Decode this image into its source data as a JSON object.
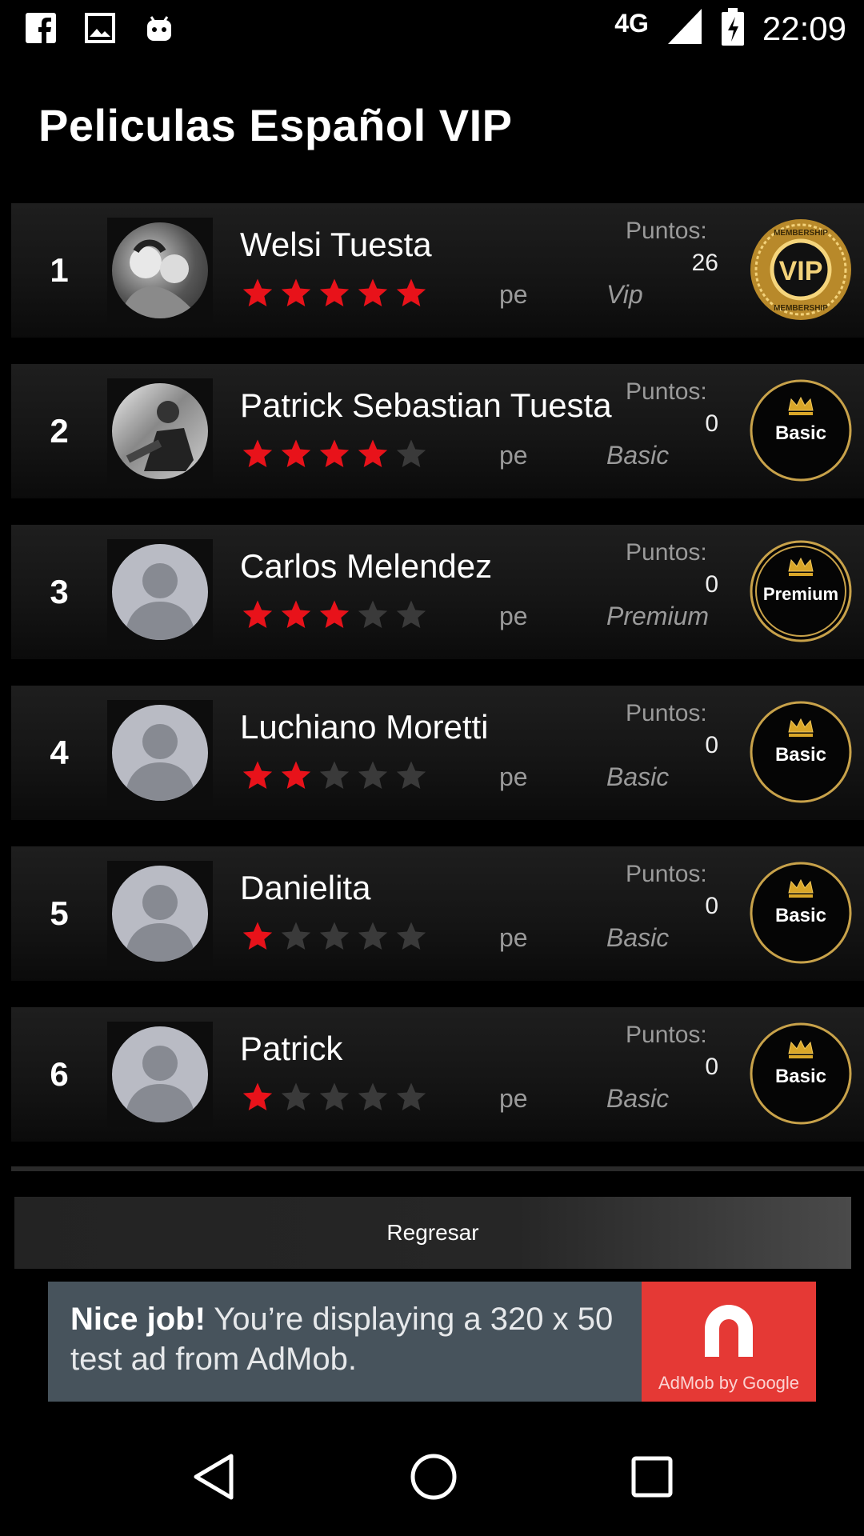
{
  "status_bar": {
    "network": "4G",
    "time": "22:09"
  },
  "title": "Peliculas Español VIP",
  "rows": [
    {
      "rank": "1",
      "name": "Welsi Tuesta",
      "rating": 5,
      "country": "pe",
      "points_label": "Puntos:",
      "points": "26",
      "tier": "Vip",
      "badge": "VIP",
      "badge_ring": [
        "MEMBERSHIP",
        "MEMBERSHIP"
      ]
    },
    {
      "rank": "2",
      "name": "Patrick Sebastian Tuesta",
      "rating": 4,
      "country": "pe",
      "points_label": "Puntos:",
      "points": "0",
      "tier": "Basic",
      "badge": "Basic"
    },
    {
      "rank": "3",
      "name": "Carlos Melendez",
      "rating": 3,
      "country": "pe",
      "points_label": "Puntos:",
      "points": "0",
      "tier": "Premium",
      "badge": "Premium"
    },
    {
      "rank": "4",
      "name": "Luchiano Moretti",
      "rating": 2,
      "country": "pe",
      "points_label": "Puntos:",
      "points": "0",
      "tier": "Basic",
      "badge": "Basic"
    },
    {
      "rank": "5",
      "name": "Danielita",
      "rating": 1,
      "country": "pe",
      "points_label": "Puntos:",
      "points": "0",
      "tier": "Basic",
      "badge": "Basic"
    },
    {
      "rank": "6",
      "name": "Patrick",
      "rating": 1,
      "country": "pe",
      "points_label": "Puntos:",
      "points": "0",
      "tier": "Basic",
      "badge": "Basic"
    }
  ],
  "back_button": "Regresar",
  "ad": {
    "bold": "Nice job!",
    "text": " You’re displaying a 320 x 50 test ad from AdMob.",
    "brand": "AdMob by Google"
  },
  "colors": {
    "star_on": "#e8121a",
    "star_off": "#3a3a3a",
    "gold": "#c8a24a",
    "ad_bg": "#47535c",
    "ad_red": "#e53935"
  },
  "icons": [
    "facebook-icon",
    "image-icon",
    "android-icon",
    "signal-icon",
    "battery-icon",
    "back-nav-icon",
    "home-nav-icon",
    "recents-nav-icon"
  ]
}
